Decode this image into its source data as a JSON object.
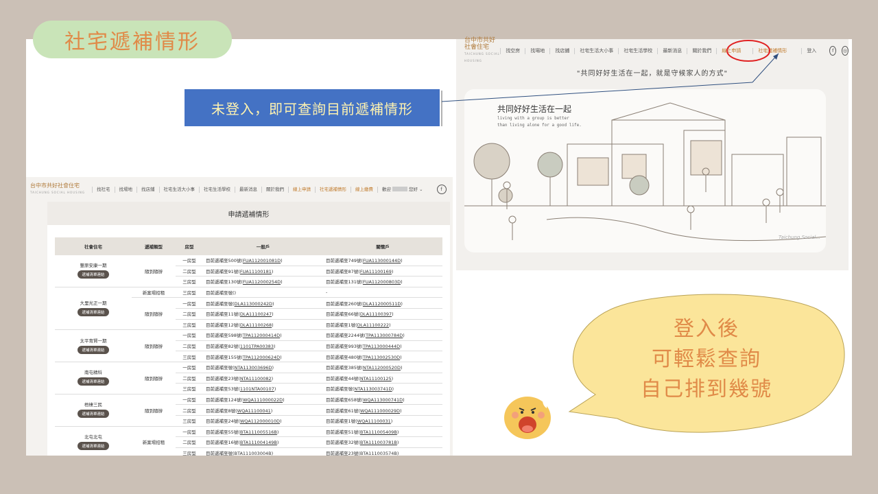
{
  "slide": {
    "title": "社宅遞補情形",
    "callout": "未登入，即可查詢目前遞補情形",
    "bubble_lines": [
      "登入後",
      "可輕鬆查詢",
      "自己排到幾號"
    ]
  },
  "right_site": {
    "logo": "台中市共好社會住宅",
    "logo_en": "TAICHUNG SOCIAL HOUSING",
    "nav": [
      "找空房",
      "找場地",
      "找店鋪",
      "社宅生活大小事",
      "社宅生活學校",
      "最新消息",
      "關於我們",
      "線上申請",
      "社宅遞補情形",
      "登入"
    ],
    "slogan": "\"共同好好生活在一起，就是守候家人的方式\"",
    "illus_title": "共同好好生活在一起",
    "illus_sub": [
      "living with a group is better",
      "than living alone for a good life."
    ],
    "illus_tag": "Taichung Social..."
  },
  "left_site": {
    "logo": "台中市共好社會住宅",
    "logo_en": "TAICHUNG SOCIAL HOUSING",
    "nav": [
      "找社宅",
      "找場地",
      "找店鋪",
      "社宅生活大小事",
      "社宅生活學校",
      "最新消息",
      "關於我們",
      "線上申請",
      "社宅遞補情形",
      "線上繳費"
    ],
    "greeting_pre": "歡迎",
    "greeting_post": "您好",
    "panel_title": "申請遞補情形",
    "headers": [
      "社會住宅",
      "遞補類型",
      "房型",
      "一般戶",
      "關懷戶"
    ],
    "button_label": "遞補清單連結",
    "groups": [
      {
        "name": "豐原安康一期",
        "rows": [
          {
            "type": "隨到隨辦",
            "room": "一房型",
            "g": "目前遞補至500號(",
            "gl": "FUA112001081D",
            "c": "目前遞補至749號(",
            "cl": "FUA113000144D"
          },
          {
            "type": "",
            "room": "二房型",
            "g": "目前遞補至91號(",
            "gl": "FUA11100181",
            "c": "目前遞補至87號(",
            "cl": "FUA11100169"
          },
          {
            "type": "",
            "room": "三房型",
            "g": "目前遞補至130號(",
            "gl": "FUA112000254D",
            "c": "目前遞補至131號(",
            "cl": "FUA112000803D"
          }
        ]
      },
      {
        "name": "大里光正一期",
        "rows": [
          {
            "type": "新案場招租",
            "room": "三房型",
            "g": "目前遞補至號(",
            "gl": "",
            "c": "-",
            "cl": ""
          },
          {
            "type": "隨到隨辦",
            "room": "一房型",
            "g": "目前遞補至號(",
            "gl": "DLA113000242D",
            "c": "目前遞補至260號(",
            "cl": "DLA112000511D"
          },
          {
            "type": "",
            "room": "二房型",
            "g": "目前遞補至11號(",
            "gl": "DLA11100247",
            "c": "目前遞補至66號(",
            "cl": "DLA11100397"
          },
          {
            "type": "",
            "room": "三房型",
            "g": "目前遞補至12號(",
            "gl": "DLA11100268",
            "c": "目前遞補至1號(",
            "cl": "DLA11100222"
          }
        ]
      },
      {
        "name": "太平育賢一期",
        "rows": [
          {
            "type": "隨到隨辦",
            "room": "一房型",
            "g": "目前遞補至598號(",
            "gl": "TPA112000414D",
            "c": "目前遞補至2244號(",
            "cl": "TPA113000784D"
          },
          {
            "type": "",
            "room": "二房型",
            "g": "目前遞補至82號(",
            "gl": "1101TPA00383",
            "c": "目前遞補至993號(",
            "cl": "TPA113000444D"
          },
          {
            "type": "",
            "room": "三房型",
            "g": "目前遞補至155號(",
            "gl": "TPA112000624D",
            "c": "目前遞補至480號(",
            "cl": "TPA113002530D"
          }
        ]
      },
      {
        "name": "南屯精科",
        "rows": [
          {
            "type": "隨到隨辦",
            "room": "一房型",
            "g": "目前遞補至號(",
            "gl": "NTA113003696D",
            "c": "目前遞補至385號(",
            "cl": "NTA112000520D"
          },
          {
            "type": "",
            "room": "二房型",
            "g": "目前遞補至23號(",
            "gl": "NTA11100082",
            "c": "目前遞補至44號(",
            "cl": "NTA11100125"
          },
          {
            "type": "",
            "room": "三房型",
            "g": "目前遞補至53號(",
            "gl": "1101NTA00107",
            "c": "目前遞補至號(",
            "cl": "NTA113003741D"
          }
        ]
      },
      {
        "name": "梧棲三民",
        "rows": [
          {
            "type": "隨到隨辦",
            "room": "一房型",
            "g": "目前遞補至124號(",
            "gl": "WQA111000022D",
            "c": "目前遞補至658號(",
            "cl": "WQA113000741D"
          },
          {
            "type": "",
            "room": "二房型",
            "g": "目前遞補至8號(",
            "gl": "WQA11100041",
            "c": "目前遞補至61號(",
            "cl": "WQA111000029D"
          },
          {
            "type": "",
            "room": "三房型",
            "g": "目前遞補至24號(",
            "gl": "WQA112000010D",
            "c": "目前遞補至1號(",
            "cl": "WQA11100031"
          }
        ]
      },
      {
        "name": "北屯北屯",
        "rows": [
          {
            "type": "新案場招租",
            "room": "一房型",
            "g": "目前遞補至55號(",
            "gl": "BTA111005516B",
            "c": "目前遞補至51號(",
            "cl": "BTA111005409B"
          },
          {
            "type": "",
            "room": "二房型",
            "g": "目前遞補至16號(",
            "gl": "BTA111004149B",
            "c": "目前遞補至32號(",
            "cl": "BTA111003781B"
          },
          {
            "type": "",
            "room": "三房型",
            "g": "目前遞補至號(",
            "gl": "BTA111003004B",
            "c": "目前遞補至23號(",
            "cl": "BTA111003574B"
          }
        ]
      }
    ]
  },
  "colors": {
    "accent": "#e08a48",
    "pill": "#c9e4b8",
    "callout": "#4472c4",
    "bubble": "#fbe59a"
  }
}
